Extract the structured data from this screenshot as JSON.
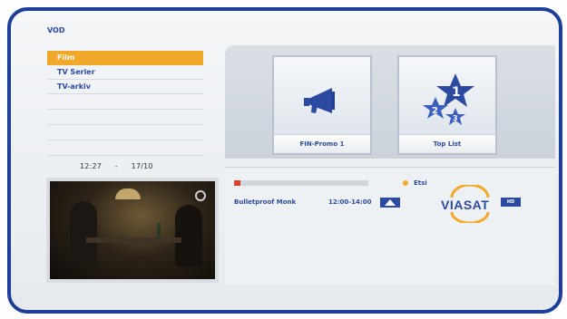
{
  "header": {
    "title": "VOD"
  },
  "menu": {
    "items": [
      {
        "label": "Film",
        "active": true
      },
      {
        "label": "TV Serier",
        "active": false
      },
      {
        "label": "TV-arkiv",
        "active": false
      }
    ]
  },
  "clock": {
    "time": "12:27",
    "separator": "-",
    "date": "17/10"
  },
  "tiles": [
    {
      "label": "FIN-Promo 1",
      "icon": "megaphone-icon"
    },
    {
      "label": "Top List",
      "icon": "stars-ranking-icon"
    }
  ],
  "program": {
    "title": "Bulletproof Monk",
    "time": "12:00-14:00",
    "progress": 0.05,
    "genre": "Etsi",
    "rating_icon": "rating-a-icon",
    "channel_logo_text": "VIASAT",
    "hd_badge_icon": "hd-icon"
  },
  "colors": {
    "frame": "#1d3f9a",
    "accent": "#f0a92a",
    "text": "#2c4aa0",
    "progress": "#e0402a"
  }
}
